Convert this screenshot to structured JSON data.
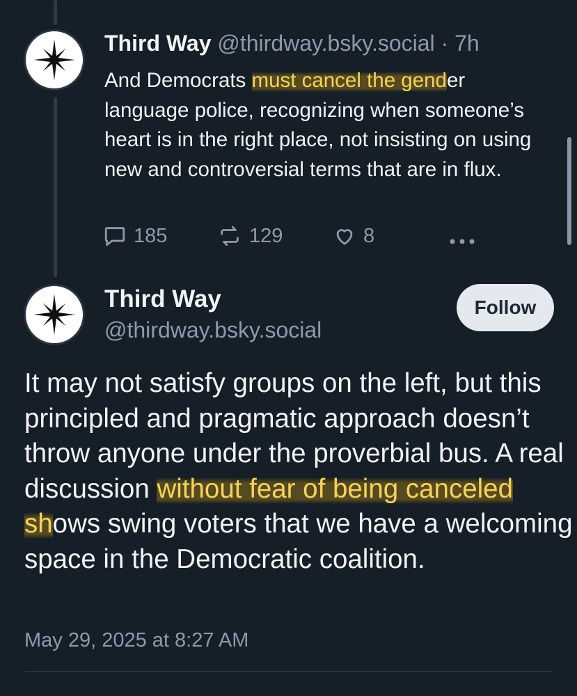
{
  "reply_post": {
    "author_name": "Third Way",
    "author_handle": "@thirdway.bsky.social",
    "time_sep": " · ",
    "time_ago": "7h",
    "text_before": "And Democrats ",
    "text_highlight": "must cancel the gend",
    "text_after": "er language police, recognizing when someone’s heart is in the right place, not insisting on using new and controversial terms that are in flux.",
    "stats": {
      "replies": "185",
      "reposts": "129",
      "likes": "8"
    },
    "icons": [
      "comment-icon",
      "repost-icon",
      "heart-icon",
      "more-icon"
    ]
  },
  "main_post": {
    "author_name": "Third Way",
    "author_handle": "@thirdway.bsky.social",
    "follow_label": "Follow",
    "text_before": "It may not satisfy groups on the left, but this principled and pragmatic approach doesn’t throw anyone under the proverbial bus. A real discussion ",
    "text_highlight": "without fear of being canceled sh",
    "text_after": "ows swing voters that we have a welcoming space in the Democratic coalition.",
    "timestamp": "May 29, 2025 at 8:27 AM"
  },
  "colors": {
    "background": "#161e27",
    "text": "#f1f3f5",
    "muted": "#8d9aab",
    "highlight": "#f7d25b",
    "follow_bg": "#e5e9ee"
  }
}
